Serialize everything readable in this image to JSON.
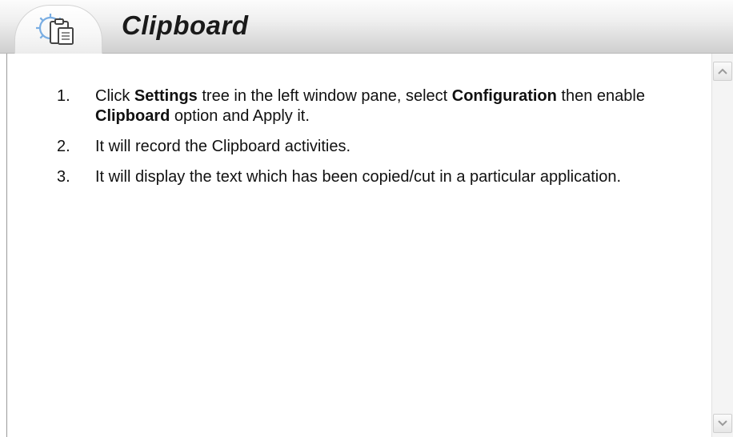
{
  "header": {
    "title": "Clipboard",
    "icon": "settings-clipboard-icon"
  },
  "steps": [
    {
      "number": "1.",
      "parts": [
        {
          "text": "Click ",
          "bold": false
        },
        {
          "text": "Settings",
          "bold": true
        },
        {
          "text": " tree in the left window pane, select ",
          "bold": false
        },
        {
          "text": "Configuration",
          "bold": true
        },
        {
          "text": " then enable ",
          "bold": false
        },
        {
          "text": "Clipboard",
          "bold": true
        },
        {
          "text": " option and Apply it.",
          "bold": false
        }
      ]
    },
    {
      "number": "2.",
      "parts": [
        {
          "text": "It will record the Clipboard activities.",
          "bold": false
        }
      ]
    },
    {
      "number": "3.",
      "parts": [
        {
          "text": "It will display the text which has been copied/cut in a particular application.",
          "bold": false
        }
      ]
    }
  ],
  "colors": {
    "icon_blue": "#6a9fd8",
    "text": "#111111"
  }
}
